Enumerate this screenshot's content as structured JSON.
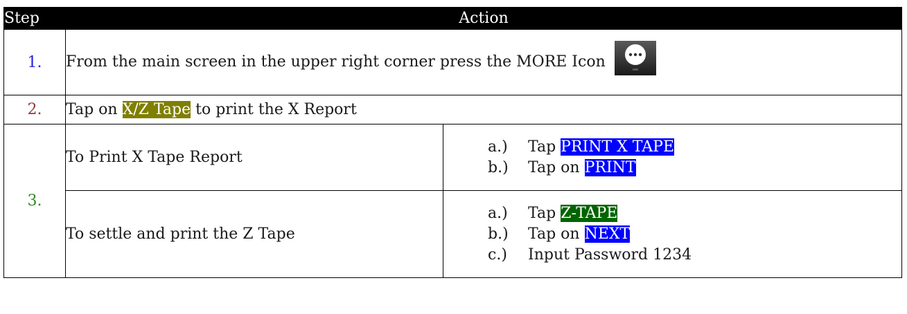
{
  "header": {
    "step_label": "Step",
    "action_label": "Action"
  },
  "rows": [
    {
      "num": "1.",
      "text": "From the main screen in the upper right corner press the MORE Icon",
      "icon": "more-icon"
    },
    {
      "num": "2.",
      "pre": "Tap on ",
      "highlight": "X/Z Tape",
      "post": " to print the X Report"
    },
    {
      "num": "3.",
      "subrows": [
        {
          "label": "To Print X Tape Report",
          "items": [
            {
              "marker": "a.)",
              "pre": "Tap ",
              "highlight": "PRINT X TAPE"
            },
            {
              "marker": "b.)",
              "pre": "Tap on ",
              "highlight": "PRINT"
            }
          ]
        },
        {
          "label": "To settle and print the Z Tape",
          "items": [
            {
              "marker": "a.)",
              "pre": "Tap ",
              "highlight": "Z-TAPE"
            },
            {
              "marker": "b.)",
              "pre": "Tap on ",
              "highlight": "NEXT"
            },
            {
              "marker": "c.)",
              "pre": "Input Password 1234",
              "highlight": ""
            }
          ]
        }
      ]
    }
  ],
  "colors": {
    "header_bg": "#000000",
    "step1": "#1f1fe0",
    "step2": "#943634",
    "step3": "#2e8b1e",
    "highlight_olive": "#7f7f00",
    "highlight_blue": "#0000ff",
    "highlight_green": "#006400"
  }
}
